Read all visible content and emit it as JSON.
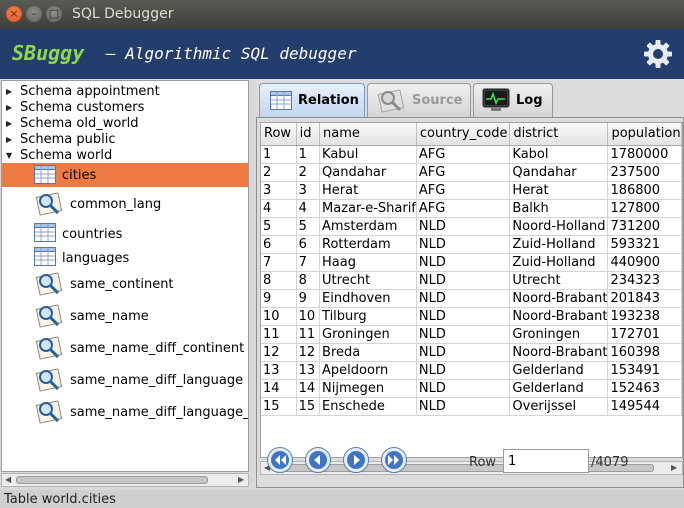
{
  "window": {
    "title": "SQL Debugger",
    "close": "×",
    "min": "–",
    "max": "□"
  },
  "header": {
    "brand": "SBuggy",
    "tagline": "– Algorithmic SQL debugger",
    "settings_icon": "gear-icon"
  },
  "tree": {
    "schemas": [
      "Schema appointment",
      "Schema customers",
      "Schema old_world",
      "Schema public",
      "Schema world"
    ],
    "items": [
      {
        "label": "cities",
        "type": "table",
        "selected": true
      },
      {
        "label": "common_lang",
        "type": "view"
      },
      {
        "label": "countries",
        "type": "table"
      },
      {
        "label": "languages",
        "type": "table"
      },
      {
        "label": "same_continent",
        "type": "view"
      },
      {
        "label": "same_name",
        "type": "view"
      },
      {
        "label": "same_name_diff_continent",
        "type": "view"
      },
      {
        "label": "same_name_diff_language",
        "type": "view"
      },
      {
        "label": "same_name_diff_language_",
        "type": "view"
      }
    ]
  },
  "tabs": [
    {
      "label": "Relation",
      "active": true,
      "icon": "table-icon"
    },
    {
      "label": "Source",
      "active": false,
      "icon": "magnifier-icon"
    },
    {
      "label": "Log",
      "active": false,
      "icon": "monitor-icon"
    }
  ],
  "grid": {
    "columns": [
      "Row",
      "id",
      "name",
      "country_code",
      "district",
      "population"
    ],
    "rows": [
      [
        "1",
        "1",
        "Kabul",
        "AFG",
        "Kabol",
        "1780000"
      ],
      [
        "2",
        "2",
        "Qandahar",
        "AFG",
        "Qandahar",
        "237500"
      ],
      [
        "3",
        "3",
        "Herat",
        "AFG",
        "Herat",
        "186800"
      ],
      [
        "4",
        "4",
        "Mazar-e-Sharif",
        "AFG",
        "Balkh",
        "127800"
      ],
      [
        "5",
        "5",
        "Amsterdam",
        "NLD",
        "Noord-Holland",
        "731200"
      ],
      [
        "6",
        "6",
        "Rotterdam",
        "NLD",
        "Zuid-Holland",
        "593321"
      ],
      [
        "7",
        "7",
        "Haag",
        "NLD",
        "Zuid-Holland",
        "440900"
      ],
      [
        "8",
        "8",
        "Utrecht",
        "NLD",
        "Utrecht",
        "234323"
      ],
      [
        "9",
        "9",
        "Eindhoven",
        "NLD",
        "Noord-Brabant",
        "201843"
      ],
      [
        "10",
        "10",
        "Tilburg",
        "NLD",
        "Noord-Brabant",
        "193238"
      ],
      [
        "11",
        "11",
        "Groningen",
        "NLD",
        "Groningen",
        "172701"
      ],
      [
        "12",
        "12",
        "Breda",
        "NLD",
        "Noord-Brabant",
        "160398"
      ],
      [
        "13",
        "13",
        "Apeldoorn",
        "NLD",
        "Gelderland",
        "153491"
      ],
      [
        "14",
        "14",
        "Nijmegen",
        "NLD",
        "Gelderland",
        "152463"
      ],
      [
        "15",
        "15",
        "Enschede",
        "NLD",
        "Overijssel",
        "149544"
      ]
    ]
  },
  "pager": {
    "row_label": "Row",
    "current_row": "1",
    "total": "/4079"
  },
  "status": "Table world.cities",
  "colors": {
    "header_bg": "#233d6d",
    "brand": "#8ed84b",
    "selection": "#ef7b43"
  }
}
